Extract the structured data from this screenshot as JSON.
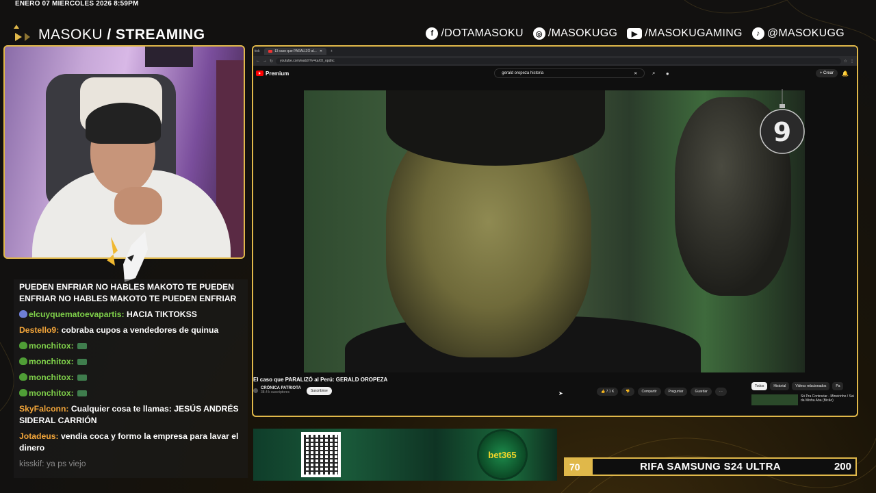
{
  "overlay": {
    "datetime": "ENERO 07 MIERCOLES 2026 8:59PM",
    "brand_left": "MASOKU",
    "brand_right": "/ STREAMING",
    "socials": [
      {
        "icon": "facebook-icon",
        "glyph": "f",
        "label": "/DOTAMASOKU"
      },
      {
        "icon": "instagram-icon",
        "glyph": "◎",
        "label": "/MASOKUGG"
      },
      {
        "icon": "youtube-icon",
        "glyph": "▶",
        "label": "/MASOKUGAMING"
      },
      {
        "icon": "tiktok-icon",
        "glyph": "♪",
        "label": "@MASOKUGG"
      }
    ],
    "accent": "#e0b84a"
  },
  "chat": {
    "messages": [
      {
        "user": "",
        "text": "PUEDEN ENFRIAR NO HABLES MAKOTO TE PUEDEN ENFRIAR NO HABLES MAKOTO TE PUEDEN ENFRIAR"
      },
      {
        "user": "elcuyquematoevapartis:",
        "text": "HACIA TIKTOKSS"
      },
      {
        "user": "Destello9:",
        "text": "cobraba cupos a vendedores de quinua"
      },
      {
        "user": "monchitox:",
        "text": ""
      },
      {
        "user": "monchitox:",
        "text": ""
      },
      {
        "user": "monchitox:",
        "text": ""
      },
      {
        "user": "monchitox:",
        "text": ""
      },
      {
        "user": "SkyFalconn:",
        "text": "Cualquier cosa te llamas: JESÚS ANDRÉS SIDERAL CARRIÓN"
      },
      {
        "user": "Jotadeus:",
        "text": "vendia coca y formo la empresa para lavar el dinero"
      },
      {
        "user": "kisskif:",
        "text": "ya ps viejo"
      }
    ]
  },
  "browser": {
    "tab_title": "El caso que PARALIZÓ al...",
    "url": "youtube.com/watch?v=kaXX_opdnc",
    "yt_brand": "Premium",
    "search_query": "gerald oropeza historia",
    "create_label": "Crear",
    "ornament_digit": "9",
    "video_title": "El caso que PARALIZÓ al Perú: GERALD OROPEZA",
    "channel_name": "CRÓNICA PATRIOTA",
    "channel_subs": "38.4 k suscriptores",
    "subscribe_label": "Suscribirse",
    "likes": "7.1 K",
    "share_label": "Compartir",
    "ask_label": "Preguntar",
    "save_label": "Guardar",
    "chips": [
      "Todos",
      "Historial",
      "Videos relacionados",
      "Pa"
    ],
    "rec_title": "Só Pra Contrariar - Mineirinho / Sai da Minha Aba (Bicão)"
  },
  "sponsor": {
    "logo_text": "bet365"
  },
  "raffle": {
    "left_num": "70",
    "title": "RIFA SAMSUNG S24 ULTRA",
    "right_num": "200"
  }
}
